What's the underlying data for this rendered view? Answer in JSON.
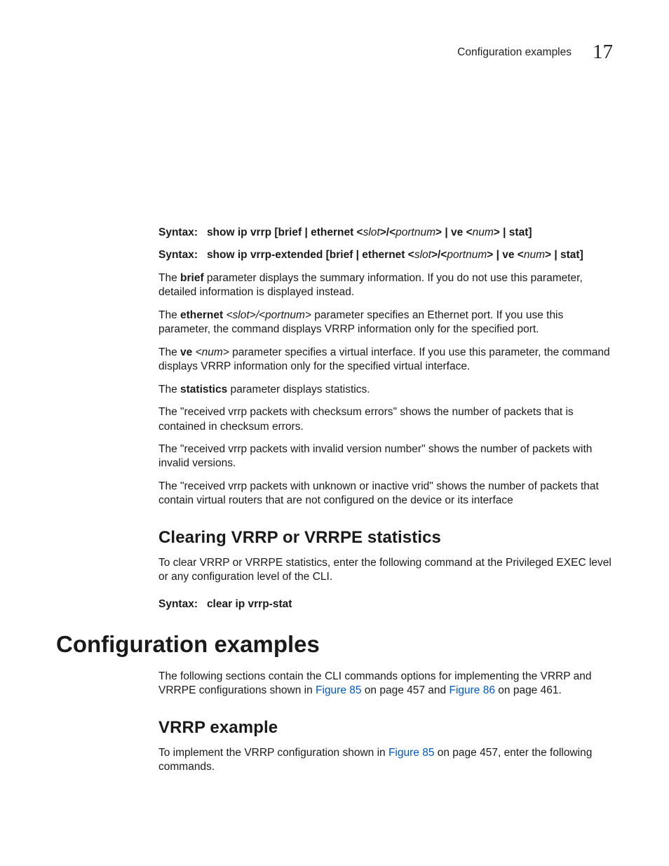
{
  "header": {
    "title": "Configuration examples",
    "chapter": "17"
  },
  "syntax1": {
    "label": "Syntax:",
    "cmd_a": "show ip vrrp [brief | ethernet <",
    "slot": "slot",
    "sep1": ">/<",
    "portnum": "portnum",
    "mid": "> | ve <",
    "num": "num",
    "end": "> | stat]"
  },
  "syntax2": {
    "label": "Syntax:",
    "cmd_a": "show ip vrrp-extended [brief | ethernet <",
    "slot": "slot",
    "sep1": ">/<",
    "portnum": "portnum",
    "mid": "> | ve <",
    "num": "num",
    "end": "> | stat]"
  },
  "p_brief": {
    "a": "The ",
    "bold": "brief",
    "b": " parameter displays the summary information.  If you do not use this parameter, detailed information is displayed instead."
  },
  "p_eth": {
    "a": "The ",
    "bold": "ethernet",
    "sp": " ",
    "i1": "<slot>/<portnum>",
    "b": " parameter specifies an Ethernet port.  If you use this parameter, the command displays VRRP information only for the specified port."
  },
  "p_ve": {
    "a": "The ",
    "bold": "ve",
    "sp": " ",
    "i1": "<num>",
    "b": " parameter specifies a virtual interface.  If you use this parameter, the command displays VRRP information only for the specified virtual interface."
  },
  "p_stats": {
    "a": "The ",
    "bold": "statistics",
    "b": " parameter displays statistics."
  },
  "p_checksum": "The \"received vrrp packets with checksum errors\" shows the number of packets that is contained in checksum errors.",
  "p_invalid": "The \"received vrrp packets with invalid version number\" shows the number of packets with invalid versions.",
  "p_unknown": "The \"received vrrp packets with unknown or inactive vrid\" shows the number of packets that contain virtual routers that are not configured on the device or its interface",
  "h_clear": "Clearing VRRP or VRRPE statistics",
  "p_clear": "To clear VRRP or VRRPE statistics, enter the following command at the Privileged EXEC level or any configuration level of the CLI.",
  "syntax3": {
    "label": "Syntax:",
    "cmd": "clear ip vrrp-stat"
  },
  "h_config": "Configuration examples",
  "p_config": {
    "a": "The following sections contain the CLI commands options for implementing the VRRP and VRRPE configurations shown in ",
    "link1": "Figure 85",
    "b": " on page 457 and ",
    "link2": "Figure 86",
    "c": " on page 461."
  },
  "h_vrrpex": "VRRP example",
  "p_vrrpex": {
    "a": "To implement the VRRP configuration shown in ",
    "link1": "Figure 85",
    "b": " on page 457, enter the following commands."
  }
}
